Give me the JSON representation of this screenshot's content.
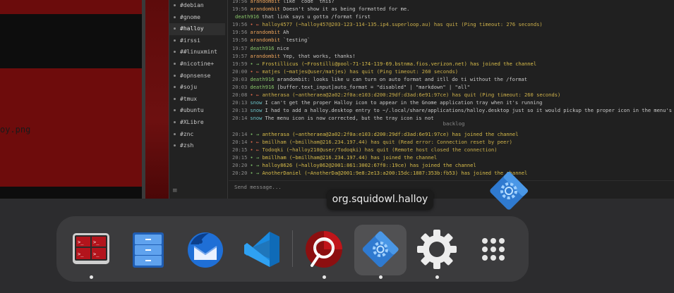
{
  "left_window": {
    "file_text": "oy.png"
  },
  "channels": [
    "#debian",
    "#gnome",
    "#halloy",
    "#irssi",
    "##linuxmint",
    "#nicotine+",
    "#opnsense",
    "#soju",
    "#tmux",
    "#ubuntu",
    "#XLibre",
    "#znc",
    "#zsh"
  ],
  "active_channel": "#halloy",
  "buffer": {
    "lines": [
      {
        "kind": "msg",
        "ts": "19:56",
        "nick": "arandombit",
        "nick_color": "c-orange",
        "text": "like `code` this?"
      },
      {
        "kind": "msg",
        "ts": "19:56",
        "nick": "arandombit",
        "nick_color": "c-orange",
        "text": "Doesn't show it as being formatted for me."
      },
      {
        "kind": "msg",
        "ts": "",
        "nick": "death916",
        "nick_color": "c-green",
        "text": "that link says u gotta /format first"
      },
      {
        "kind": "quit",
        "ts": "19:56",
        "text": "halloy4577 (~halloy457@203-123-114-135.ip4.superloop.au) has quit (Ping timeout: 276 seconds)"
      },
      {
        "kind": "msg",
        "ts": "19:56",
        "nick": "arandombit",
        "nick_color": "c-orange",
        "text": "Ah"
      },
      {
        "kind": "msg",
        "ts": "19:56",
        "nick": "arandombit",
        "nick_color": "c-orange",
        "text": "`testing`"
      },
      {
        "kind": "msg",
        "ts": "19:57",
        "nick": "death916",
        "nick_color": "c-green",
        "text": "nice"
      },
      {
        "kind": "msg",
        "ts": "19:57",
        "nick": "arandombit",
        "nick_color": "c-orange",
        "text": "Yep, that works, thanks!"
      },
      {
        "kind": "join",
        "ts": "19:59",
        "text": "Frostillicus (~Frostilli@pool-71-174-119-69.bstnma.fios.verizon.net) has joined the channel"
      },
      {
        "kind": "quit",
        "ts": "20:00",
        "text": "matjes (~matjes@user/matjes) has quit (Ping timeout: 260 seconds)"
      },
      {
        "kind": "msg",
        "ts": "20:03",
        "nick": "death916",
        "nick_color": "c-green",
        "text": "arandombit: looks like u can turn on auto format and itll do ti without the /format"
      },
      {
        "kind": "msg",
        "ts": "20:03",
        "nick": "death916",
        "nick_color": "c-green",
        "text": "[buffer.text_input]auto_format = \"disabled\" | \"markdown\" | \"all\""
      },
      {
        "kind": "quit",
        "ts": "20:08",
        "text": "antherasa (~antheraea@2a02:2f0a:e103:d200:29df:d3ad:6e91:97ce) has quit (Ping timeout: 260 seconds)"
      },
      {
        "kind": "msg",
        "ts": "20:13",
        "nick": "snow",
        "nick_color": "c-teal",
        "text": "I can't get the proper Halloy icon to appear in the Gnome application tray when it's running"
      },
      {
        "kind": "msg",
        "ts": "20:13",
        "nick": "snow",
        "nick_color": "c-teal",
        "text": "I had to add a halloy.desktop entry to ~/.local/share/applications/halloy.desktop just so it would pickup the proper icon in the menu's"
      },
      {
        "kind": "msg",
        "ts": "20:14",
        "nick": "snow",
        "nick_color": "c-teal",
        "text": "The menu icon is now corrected, but the tray icon is not"
      },
      {
        "kind": "gap"
      },
      {
        "kind": "join",
        "ts": "20:14",
        "text": "antherasa (~antheraea@2a02:2f0a:e103:d200:29df:d3ad:6e91:97ce) has joined the channel"
      },
      {
        "kind": "quit",
        "ts": "20:14",
        "text": "bmillham (~bmillham@216.234.197.44) has quit (Read error: Connection reset by peer)"
      },
      {
        "kind": "quit",
        "ts": "20:15",
        "text": "Todoqki (~halloy210@user/Todoqki) has quit (Remote host closed the connection)"
      },
      {
        "kind": "join",
        "ts": "20:15",
        "text": "bmillham (~bmillham@216.234.197.44) has joined the channel"
      },
      {
        "kind": "join",
        "ts": "20:20",
        "text": "halloy8626 (~halloy862@2001:861:3002:67f0::19ce) has joined the channel"
      },
      {
        "kind": "join",
        "ts": "20:20",
        "text": "AnotherDaniel (~AnotherDa@2001:9e8:2e13:a200:15dc:1887:353b:fb53) has joined the channel"
      }
    ],
    "backlog_label": "backlog"
  },
  "input": {
    "placeholder": "Send message..."
  },
  "tooltip": {
    "text": "org.squidowl.halloy"
  },
  "dock": {
    "items": [
      {
        "name": "terminal-app",
        "running": true
      },
      {
        "name": "files-app",
        "running": false
      },
      {
        "name": "thunderbird-app",
        "running": false
      },
      {
        "name": "vscode-app",
        "running": false
      },
      {
        "name": "browser-app",
        "running": true
      },
      {
        "name": "halloy-app",
        "running": true,
        "selected": true
      },
      {
        "name": "settings-app",
        "running": true
      },
      {
        "name": "app-grid",
        "running": false
      }
    ]
  },
  "colors": {
    "dock_bg": "#3b3b3d",
    "halloy_blue": "#2f7ad0",
    "terminal_red": "#b3141c"
  }
}
